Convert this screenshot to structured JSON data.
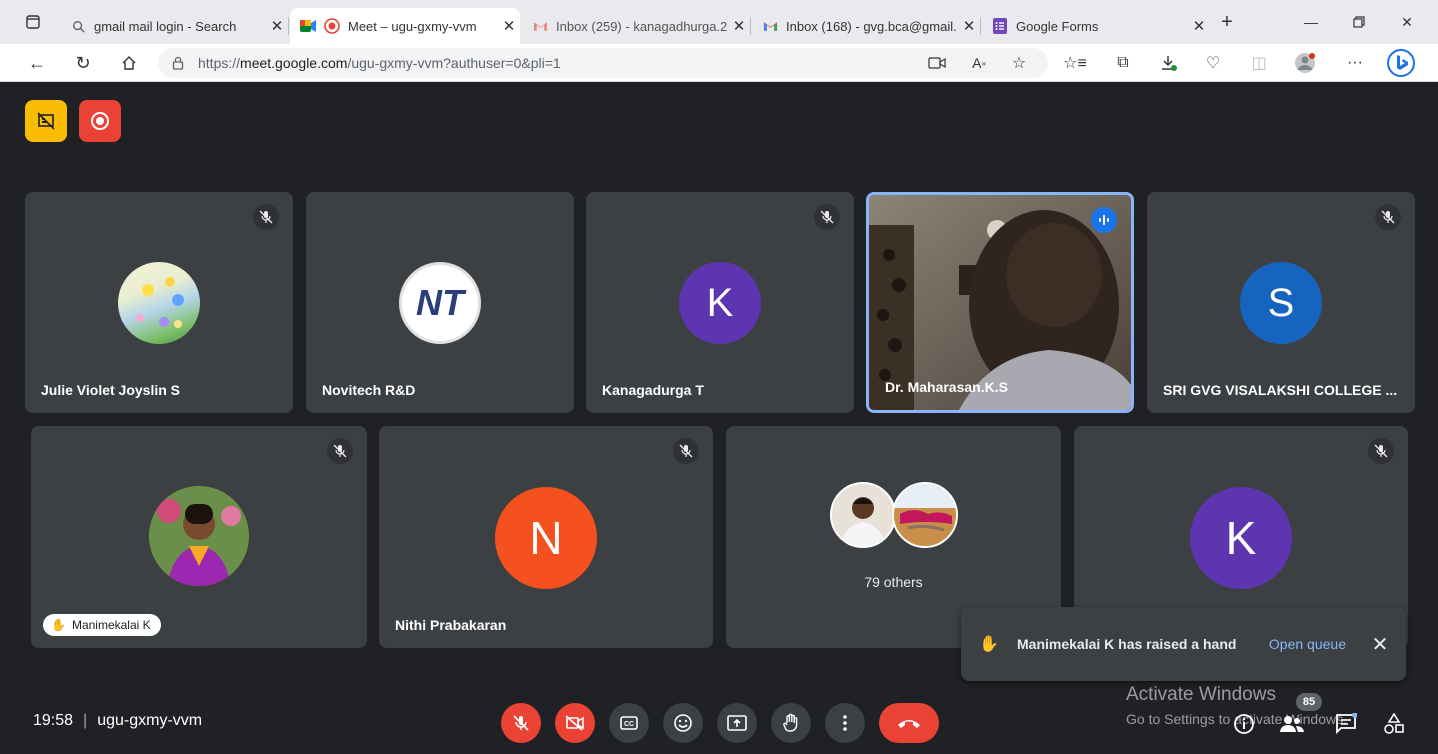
{
  "browser": {
    "tabs": [
      {
        "title": "gmail mail login - Search",
        "icon": "search-icon"
      },
      {
        "title": "Meet – ugu-gxmy-vvm",
        "icon": "meet-icon"
      },
      {
        "title": "Inbox (259) - kanagadhurga.2",
        "icon": "gmail-icon"
      },
      {
        "title": "Inbox (168) - gvg.bca@gmail.",
        "icon": "gmail-icon"
      },
      {
        "title": "Google Forms",
        "icon": "forms-icon"
      }
    ],
    "url_prefix": "https://",
    "url_host": "meet.google.com",
    "url_path": "/ugu-gxmy-vvm?authuser=0&pli=1"
  },
  "meet": {
    "participants_row1": [
      {
        "name": "Julie Violet Joyslin S",
        "avatar": "photo",
        "muted": true
      },
      {
        "name": "Novitech R&D",
        "avatar": "NT",
        "muted": false
      },
      {
        "name": "Kanagadurga T",
        "avatar": "K",
        "avatar_color": "#5e35b1",
        "muted": true
      },
      {
        "name": "Dr. Maharasan.K.S",
        "avatar": "video",
        "speaking": true
      },
      {
        "name": "SRI GVG VISALAKSHI COLLEGE ...",
        "avatar": "S",
        "avatar_color": "#1565c0",
        "muted": true
      }
    ],
    "participants_row2": [
      {
        "name": "Manimekalai K",
        "avatar": "photo",
        "muted": true,
        "hand_raised": true
      },
      {
        "name": "Nithi Prabakaran",
        "avatar": "N",
        "avatar_color": "#f4511e",
        "muted": true
      },
      {
        "name": "79 others",
        "avatar": "group"
      },
      {
        "name": "",
        "avatar": "K",
        "avatar_color": "#5e35b1",
        "muted": true
      }
    ],
    "toast": {
      "message": "Manimekalai K has raised a hand",
      "action": "Open queue"
    },
    "watermark": {
      "line1": "Activate Windows",
      "line2": "Go to Settings to activate Windows."
    },
    "participant_count": "85",
    "time": "19:58",
    "separator": "|",
    "meeting_code": "ugu-gxmy-vvm",
    "colors": {
      "background": "#202124",
      "tile": "#3c4043",
      "danger": "#ea4335",
      "accent": "#8ab4f8"
    }
  }
}
